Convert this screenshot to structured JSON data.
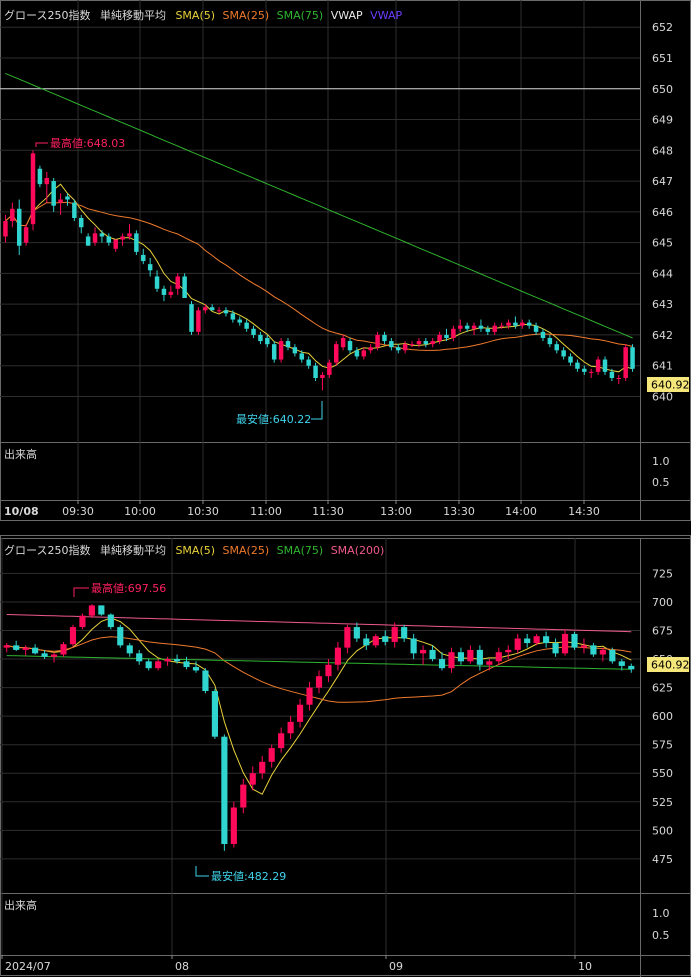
{
  "colors": {
    "up": "#ff0a5a",
    "down": "#30d5d0",
    "sma5": "#e9d23a",
    "sma25": "#f07a2c",
    "sma75": "#2fb52f",
    "sma200": "#f05a8c",
    "vwap": "#6a3cff",
    "high_label": "#ff2060",
    "low_label": "#3fd3ea",
    "price_box": "#f5e77a"
  },
  "top_chart": {
    "legend": {
      "name": "グロース250指数",
      "ma_title": "単純移動平均",
      "sma5": "SMA(5)",
      "sma25": "SMA(25)",
      "sma75": "SMA(75)",
      "vwap_label": "VWAP",
      "vwap_line": "VWAP"
    },
    "volume_title": "出来高",
    "volume_ticks": [
      "1.0",
      "0.5"
    ],
    "high_label": "最高値:648.03",
    "low_label": "最安値:640.22",
    "last_price": "640.92",
    "date_label": "10/08",
    "time_ticks": [
      "09:30",
      "10:00",
      "10:30",
      "11:00",
      "11:30",
      "13:00",
      "13:30",
      "14:00",
      "14:30"
    ]
  },
  "bottom_chart": {
    "legend": {
      "name": "グロース250指数",
      "ma_title": "単純移動平均",
      "sma5": "SMA(5)",
      "sma25": "SMA(25)",
      "sma75": "SMA(75)",
      "sma200": "SMA(200)"
    },
    "volume_title": "出来高",
    "volume_ticks": [
      "1.0",
      "0.5"
    ],
    "high_label": "最高値:697.56",
    "low_label": "最安値:482.29",
    "last_price": "640.92",
    "date_ticks": [
      "2024/07",
      "08",
      "09",
      "10"
    ]
  },
  "chart_data": [
    {
      "type": "candlestick",
      "title": "グロース250指数",
      "interval": "intraday",
      "date": "10/08",
      "ylim": [
        639.3,
        652.3
      ],
      "y_ticks": [
        640,
        641,
        642,
        643,
        644,
        645,
        646,
        647,
        648,
        649,
        650,
        651,
        652
      ],
      "x_ticks": [
        "09:30",
        "10:00",
        "10:30",
        "11:00",
        "11:30",
        "13:00",
        "13:30",
        "14:00",
        "14:30"
      ],
      "reference_line": 650,
      "candles": [
        [
          645.2,
          645.9,
          645.0,
          645.7
        ],
        [
          645.7,
          646.3,
          645.5,
          646.1
        ],
        [
          646.1,
          646.4,
          644.6,
          644.9
        ],
        [
          645.0,
          645.6,
          644.9,
          645.5
        ],
        [
          645.6,
          648.0,
          645.4,
          647.9
        ],
        [
          647.4,
          647.5,
          646.8,
          646.9
        ],
        [
          646.9,
          647.3,
          646.3,
          647.1
        ],
        [
          647.0,
          647.1,
          646.0,
          646.2
        ],
        [
          646.3,
          646.6,
          645.9,
          646.4
        ],
        [
          646.5,
          646.6,
          646.2,
          646.4
        ],
        [
          646.3,
          646.4,
          645.7,
          645.8
        ],
        [
          645.8,
          645.9,
          645.3,
          645.5
        ],
        [
          645.2,
          645.3,
          644.9,
          644.9
        ],
        [
          645.0,
          645.5,
          644.9,
          645.3
        ],
        [
          645.3,
          645.4,
          645.0,
          645.2
        ],
        [
          645.2,
          645.3,
          644.9,
          645.0
        ],
        [
          644.8,
          645.1,
          644.7,
          645.1
        ],
        [
          645.1,
          645.3,
          644.9,
          645.2
        ],
        [
          645.2,
          645.6,
          645.1,
          645.3
        ],
        [
          645.3,
          645.4,
          644.6,
          644.7
        ],
        [
          644.6,
          644.8,
          644.3,
          644.4
        ],
        [
          644.3,
          644.5,
          643.9,
          644.1
        ],
        [
          643.9,
          644.1,
          643.4,
          643.5
        ],
        [
          643.5,
          643.6,
          643.1,
          643.3
        ],
        [
          643.3,
          643.6,
          643.2,
          643.4
        ],
        [
          643.5,
          644.0,
          643.3,
          643.9
        ],
        [
          643.9,
          644.0,
          643.2,
          643.2
        ],
        [
          643.0,
          643.1,
          642.0,
          642.1
        ],
        [
          642.1,
          642.9,
          642.0,
          642.8
        ],
        [
          642.8,
          643.0,
          642.7,
          642.9
        ],
        [
          642.9,
          643.0,
          642.8,
          642.8
        ],
        [
          642.8,
          642.9,
          642.7,
          642.8
        ],
        [
          642.8,
          642.9,
          642.6,
          642.7
        ],
        [
          642.7,
          642.8,
          642.4,
          642.5
        ],
        [
          642.5,
          642.6,
          642.3,
          642.4
        ],
        [
          642.4,
          642.5,
          642.1,
          642.2
        ],
        [
          642.2,
          642.3,
          641.9,
          642.0
        ],
        [
          642.0,
          642.1,
          641.7,
          641.8
        ],
        [
          641.9,
          642.0,
          641.6,
          641.7
        ],
        [
          641.7,
          641.8,
          641.1,
          641.2
        ],
        [
          641.2,
          641.9,
          641.1,
          641.8
        ],
        [
          641.8,
          641.9,
          641.5,
          641.6
        ],
        [
          641.6,
          641.7,
          641.3,
          641.4
        ],
        [
          641.4,
          641.5,
          641.1,
          641.2
        ],
        [
          641.2,
          641.3,
          640.9,
          641.0
        ],
        [
          641.0,
          641.1,
          640.5,
          640.6
        ],
        [
          640.6,
          640.8,
          640.2,
          640.7
        ],
        [
          640.7,
          641.2,
          640.6,
          641.1
        ],
        [
          641.1,
          641.8,
          641.0,
          641.7
        ],
        [
          641.6,
          642.0,
          641.5,
          641.9
        ],
        [
          641.8,
          641.9,
          641.4,
          641.5
        ],
        [
          641.5,
          641.6,
          641.2,
          641.3
        ],
        [
          641.3,
          641.6,
          641.2,
          641.5
        ],
        [
          641.5,
          641.7,
          641.4,
          641.6
        ],
        [
          641.6,
          642.1,
          641.5,
          642.0
        ],
        [
          642.0,
          642.1,
          641.7,
          641.8
        ],
        [
          641.8,
          641.9,
          641.5,
          641.6
        ],
        [
          641.6,
          641.7,
          641.4,
          641.5
        ],
        [
          641.5,
          641.8,
          641.4,
          641.7
        ],
        [
          641.7,
          641.8,
          641.6,
          641.7
        ],
        [
          641.7,
          641.9,
          641.6,
          641.8
        ],
        [
          641.8,
          641.9,
          641.6,
          641.7
        ],
        [
          641.7,
          641.9,
          641.6,
          641.8
        ],
        [
          641.8,
          642.1,
          641.7,
          642.0
        ],
        [
          642.0,
          642.2,
          641.8,
          641.9
        ],
        [
          641.9,
          642.3,
          641.8,
          642.2
        ],
        [
          642.2,
          642.5,
          642.1,
          642.3
        ],
        [
          642.3,
          642.4,
          642.1,
          642.2
        ],
        [
          642.2,
          642.4,
          642.0,
          642.3
        ],
        [
          642.3,
          642.5,
          642.1,
          642.2
        ],
        [
          642.2,
          642.3,
          642.0,
          642.1
        ],
        [
          642.1,
          642.4,
          642.0,
          642.3
        ],
        [
          642.3,
          642.4,
          642.2,
          642.3
        ],
        [
          642.3,
          642.5,
          642.2,
          642.4
        ],
        [
          642.4,
          642.6,
          642.2,
          642.3
        ],
        [
          642.3,
          642.5,
          642.2,
          642.4
        ],
        [
          642.4,
          642.5,
          642.2,
          642.3
        ],
        [
          642.3,
          642.4,
          642.0,
          642.1
        ],
        [
          642.1,
          642.2,
          641.8,
          641.9
        ],
        [
          641.9,
          642.0,
          641.6,
          641.7
        ],
        [
          641.7,
          641.8,
          641.4,
          641.5
        ],
        [
          641.5,
          641.6,
          641.2,
          641.3
        ],
        [
          641.3,
          641.4,
          641.0,
          641.1
        ],
        [
          641.1,
          641.2,
          640.8,
          640.9
        ],
        [
          640.9,
          641.0,
          640.7,
          640.8
        ],
        [
          640.8,
          640.9,
          640.6,
          640.8
        ],
        [
          640.8,
          641.3,
          640.7,
          641.2
        ],
        [
          641.2,
          641.3,
          640.7,
          640.8
        ],
        [
          640.8,
          640.9,
          640.5,
          640.6
        ],
        [
          640.6,
          640.7,
          640.4,
          640.6
        ],
        [
          640.6,
          641.7,
          640.5,
          641.6
        ],
        [
          641.6,
          641.7,
          640.8,
          640.9
        ]
      ],
      "high": 648.03,
      "low": 640.22,
      "last": 640.92
    },
    {
      "type": "candlestick",
      "title": "グロース250指数",
      "interval": "daily",
      "ylim": [
        460,
        735
      ],
      "y_ticks": [
        475,
        500,
        525,
        550,
        575,
        600,
        625,
        650,
        675,
        700,
        725
      ],
      "x_ticks": [
        "2024/07",
        "08",
        "09",
        "10"
      ],
      "candles": [
        [
          660,
          664,
          656,
          662
        ],
        [
          662,
          666,
          657,
          658
        ],
        [
          658,
          662,
          653,
          660
        ],
        [
          660,
          663,
          654,
          655
        ],
        [
          655,
          658,
          650,
          652
        ],
        [
          652,
          656,
          647,
          654
        ],
        [
          654,
          665,
          652,
          663
        ],
        [
          663,
          680,
          661,
          678
        ],
        [
          678,
          690,
          676,
          688
        ],
        [
          688,
          698,
          686,
          697
        ],
        [
          697,
          697,
          688,
          689
        ],
        [
          689,
          690,
          676,
          678
        ],
        [
          678,
          680,
          660,
          662
        ],
        [
          662,
          664,
          652,
          655
        ],
        [
          655,
          658,
          645,
          648
        ],
        [
          648,
          650,
          640,
          642
        ],
        [
          642,
          650,
          640,
          648
        ],
        [
          648,
          652,
          644,
          650
        ],
        [
          650,
          654,
          646,
          648
        ],
        [
          648,
          652,
          641,
          643
        ],
        [
          643,
          648,
          638,
          640
        ],
        [
          640,
          642,
          620,
          622
        ],
        [
          622,
          624,
          580,
          582
        ],
        [
          582,
          584,
          482,
          488
        ],
        [
          488,
          525,
          485,
          520
        ],
        [
          520,
          545,
          515,
          540
        ],
        [
          540,
          556,
          535,
          550
        ],
        [
          550,
          565,
          545,
          560
        ],
        [
          560,
          575,
          555,
          572
        ],
        [
          572,
          590,
          568,
          585
        ],
        [
          585,
          600,
          580,
          595
        ],
        [
          595,
          615,
          590,
          610
        ],
        [
          610,
          630,
          605,
          625
        ],
        [
          625,
          640,
          620,
          635
        ],
        [
          635,
          650,
          630,
          645
        ],
        [
          645,
          665,
          640,
          660
        ],
        [
          660,
          680,
          655,
          678
        ],
        [
          678,
          682,
          665,
          668
        ],
        [
          668,
          672,
          658,
          662
        ],
        [
          662,
          672,
          660,
          670
        ],
        [
          670,
          675,
          662,
          665
        ],
        [
          665,
          682,
          660,
          678
        ],
        [
          678,
          680,
          665,
          668
        ],
        [
          668,
          672,
          650,
          655
        ],
        [
          655,
          662,
          645,
          658
        ],
        [
          658,
          662,
          648,
          650
        ],
        [
          650,
          656,
          640,
          642
        ],
        [
          642,
          660,
          638,
          656
        ],
        [
          656,
          660,
          645,
          648
        ],
        [
          648,
          662,
          646,
          658
        ],
        [
          658,
          662,
          640,
          645
        ],
        [
          645,
          650,
          640,
          648
        ],
        [
          648,
          660,
          645,
          656
        ],
        [
          656,
          662,
          650,
          658
        ],
        [
          658,
          672,
          655,
          668
        ],
        [
          668,
          672,
          660,
          664
        ],
        [
          664,
          672,
          662,
          670
        ],
        [
          670,
          674,
          660,
          664
        ],
        [
          664,
          668,
          652,
          655
        ],
        [
          655,
          676,
          653,
          672
        ],
        [
          672,
          674,
          658,
          660
        ],
        [
          660,
          668,
          655,
          662
        ],
        [
          662,
          664,
          652,
          654
        ],
        [
          654,
          660,
          648,
          658
        ],
        [
          658,
          660,
          646,
          648
        ],
        [
          648,
          650,
          640,
          644
        ],
        [
          644,
          646,
          638,
          641
        ]
      ],
      "high": 697.56,
      "low": 482.29,
      "last": 640.92
    }
  ]
}
